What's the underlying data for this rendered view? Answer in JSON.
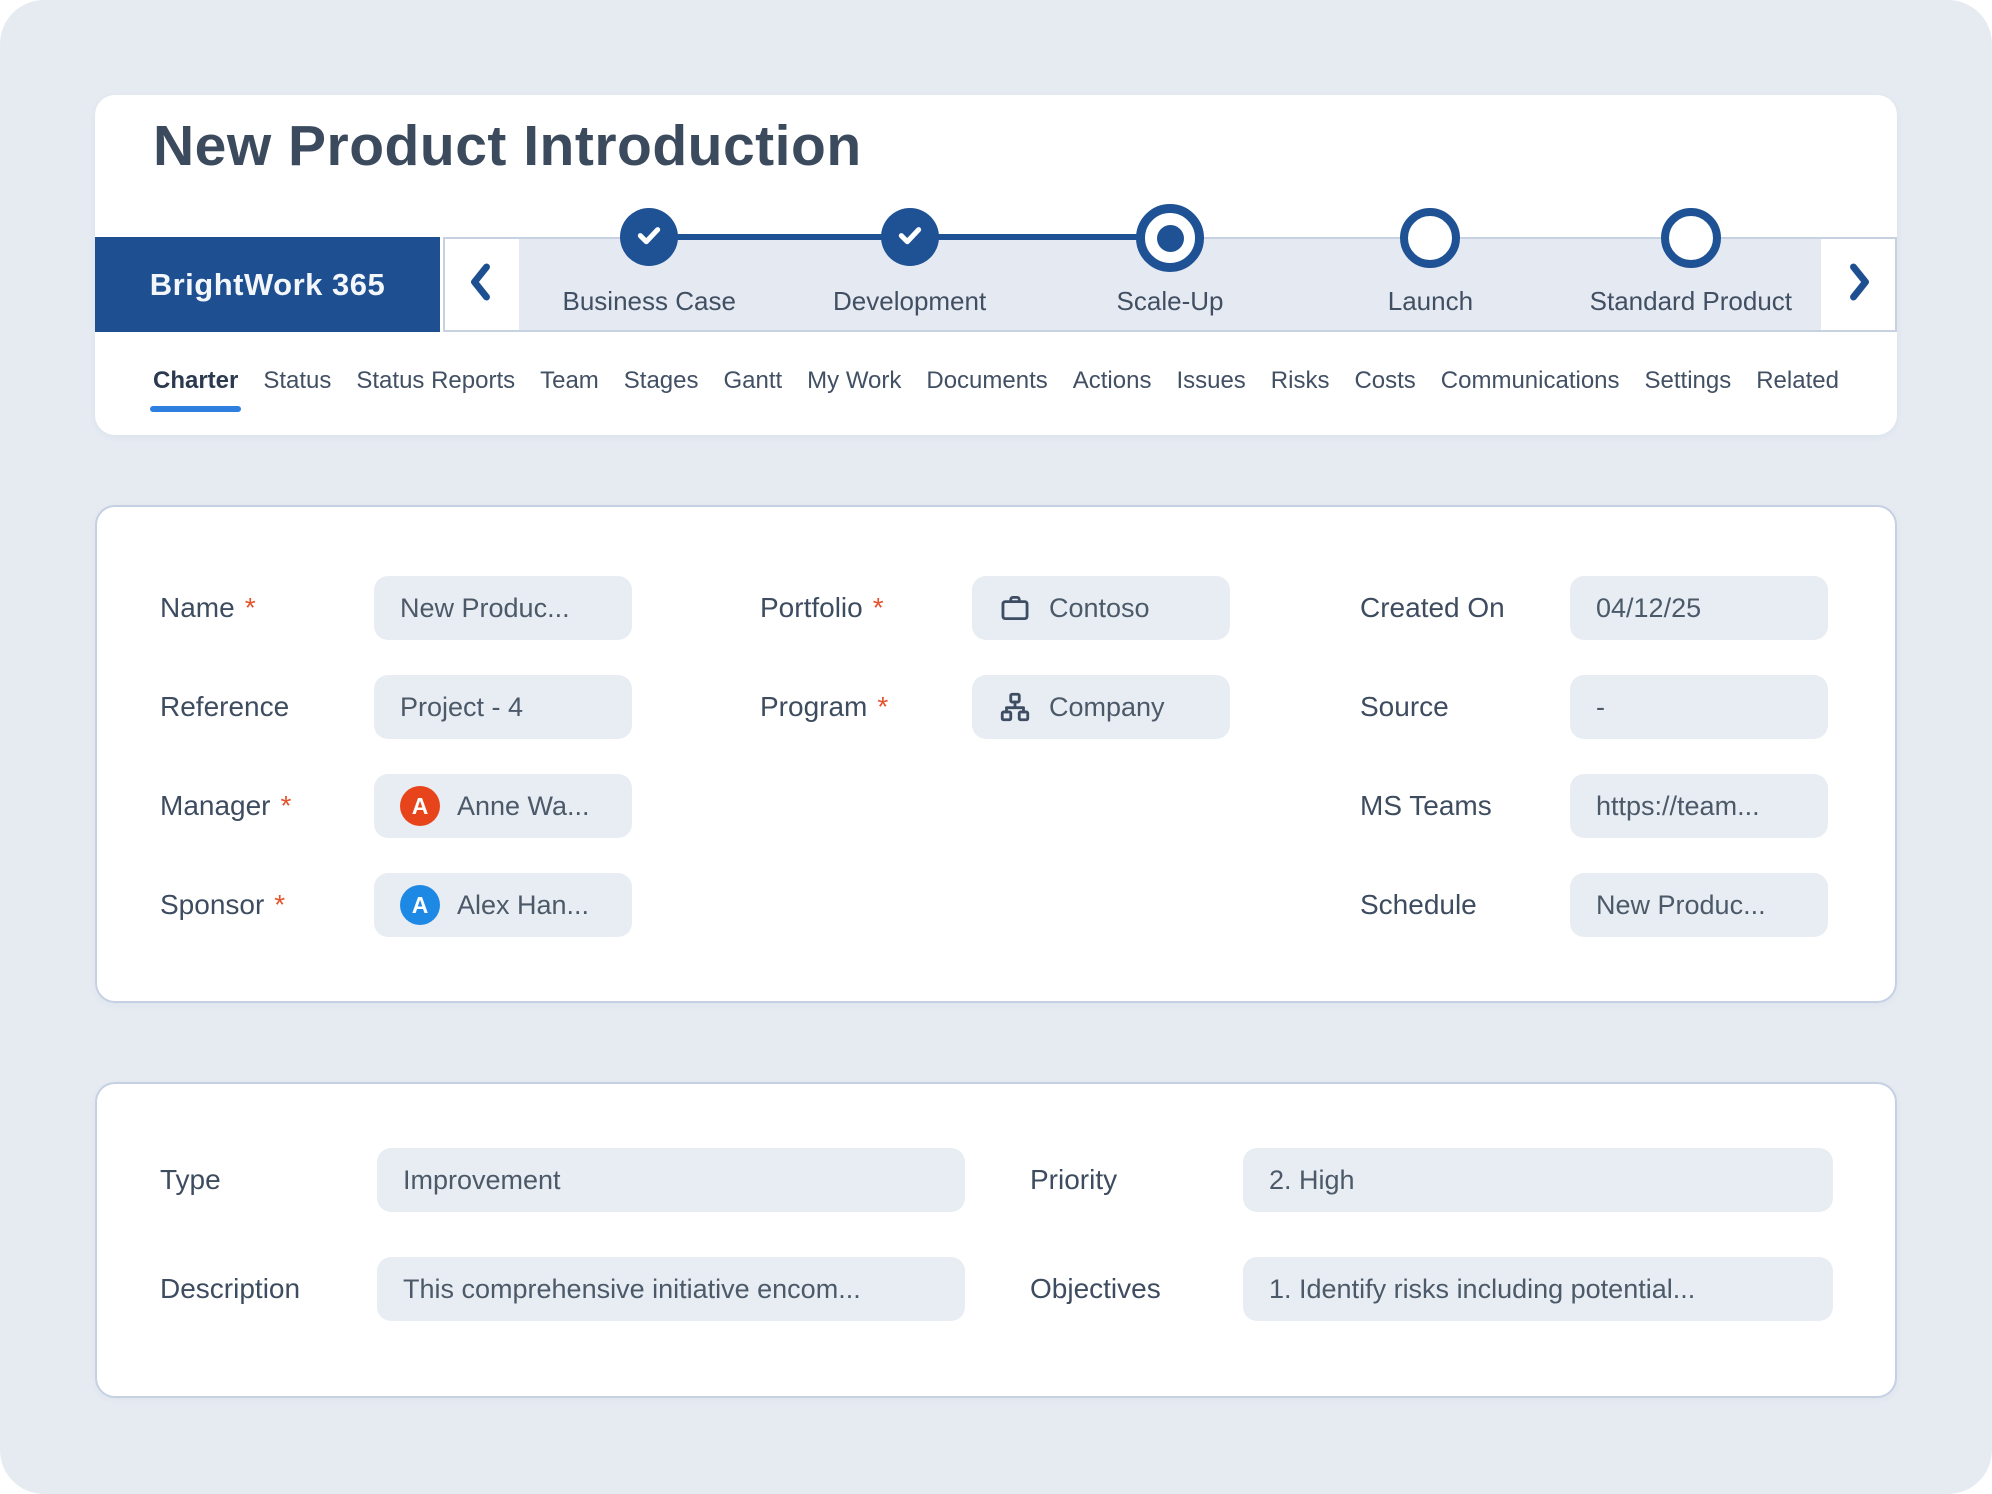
{
  "page_title": "New Product Introduction",
  "brand": {
    "label": "BrightWork 365"
  },
  "stage_nav": {
    "back_icon": "chevron-left-icon",
    "forward_icon": "chevron-right-icon",
    "stages": [
      {
        "label": "Business Case",
        "status": "completed"
      },
      {
        "label": "Development",
        "status": "completed"
      },
      {
        "label": "Scale-Up",
        "status": "active"
      },
      {
        "label": "Launch",
        "status": "upcoming"
      },
      {
        "label": "Standard Product",
        "status": "upcoming"
      }
    ]
  },
  "tabs": {
    "items": [
      {
        "label": "Charter",
        "active": true
      },
      {
        "label": "Status"
      },
      {
        "label": "Status Reports"
      },
      {
        "label": "Team"
      },
      {
        "label": "Stages"
      },
      {
        "label": "Gantt"
      },
      {
        "label": "My Work"
      },
      {
        "label": "Documents"
      },
      {
        "label": "Actions"
      },
      {
        "label": "Issues"
      },
      {
        "label": "Risks"
      },
      {
        "label": "Costs"
      },
      {
        "label": "Communications"
      },
      {
        "label": "Settings"
      },
      {
        "label": "Related"
      }
    ]
  },
  "charter_form": {
    "required_marker": "*",
    "name": {
      "label": "Name",
      "required": true,
      "value": "New Produc..."
    },
    "reference": {
      "label": "Reference",
      "required": false,
      "value": "Project - 4"
    },
    "manager": {
      "label": "Manager",
      "required": true,
      "value": "Anne Wa...",
      "avatar_initial": "A",
      "avatar_color": "#e8441c"
    },
    "sponsor": {
      "label": "Sponsor",
      "required": true,
      "value": "Alex Han...",
      "avatar_initial": "A",
      "avatar_color": "#1e88e5"
    },
    "portfolio": {
      "label": "Portfolio",
      "required": true,
      "value": "Contoso",
      "icon": "briefcase-icon"
    },
    "program": {
      "label": "Program",
      "required": true,
      "value": "Company",
      "icon": "org-chart-icon"
    },
    "created_on": {
      "label": "Created On",
      "required": false,
      "value": "04/12/25"
    },
    "source": {
      "label": "Source",
      "required": false,
      "value": "-"
    },
    "ms_teams": {
      "label": "MS Teams",
      "required": false,
      "value": "https://team..."
    },
    "schedule": {
      "label": "Schedule",
      "required": false,
      "value": "New Produc..."
    }
  },
  "details_form": {
    "type": {
      "label": "Type",
      "value": "Improvement"
    },
    "priority": {
      "label": "Priority",
      "value": "2. High"
    },
    "description": {
      "label": "Description",
      "value": "This comprehensive initiative encom..."
    },
    "objectives": {
      "label": "Objectives",
      "value": "1. Identify risks including potential..."
    }
  },
  "colors": {
    "brand_blue": "#1e4f90",
    "stage_blue": "#1e5294",
    "accent_tab_underline": "#2e7fe0",
    "required_marker": "#e4532c",
    "page_background": "#e6ebf2",
    "field_background": "#e8edf3",
    "track_border": "#c6d2e2",
    "manager_avatar": "#e8441c",
    "sponsor_avatar": "#1e88e5"
  }
}
